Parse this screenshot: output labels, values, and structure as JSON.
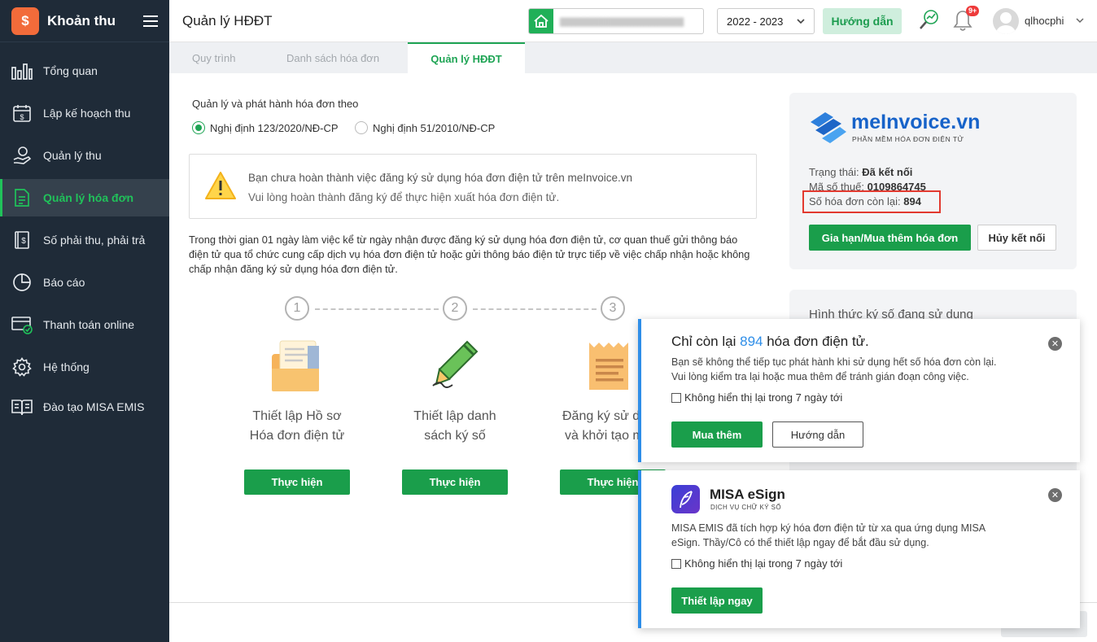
{
  "app": {
    "name": "Khoản thu"
  },
  "sidebar": {
    "items": [
      {
        "label": "Tổng quan",
        "icon": "bar-chart-icon"
      },
      {
        "label": "Lập kế hoạch thu",
        "icon": "calendar-money-icon"
      },
      {
        "label": "Quản lý thu",
        "icon": "hand-coin-icon"
      },
      {
        "label": "Quản lý hóa đơn",
        "icon": "invoice-document-icon",
        "active": true
      },
      {
        "label": "Số phải thu, phải trả",
        "icon": "money-book-icon"
      },
      {
        "label": "Báo cáo",
        "icon": "pie-chart-icon"
      },
      {
        "label": "Thanh toán online",
        "icon": "online-payment-icon"
      },
      {
        "label": "Hệ thống",
        "icon": "gear-icon"
      },
      {
        "label": "Đào tạo MISA EMIS",
        "icon": "open-book-icon"
      }
    ]
  },
  "header": {
    "title": "Quản lý HĐĐT",
    "year": "2022 - 2023",
    "guide": "Hướng dẫn",
    "notif_badge": "9+",
    "user": "qlhocphi"
  },
  "tabs": [
    {
      "label": "Quy trình",
      "active": false
    },
    {
      "label": "Danh sách hóa đơn",
      "active": false
    },
    {
      "label": "Quản lý HĐĐT",
      "active": true
    }
  ],
  "main": {
    "intro": "Quản lý và phát hành hóa đơn theo",
    "radio1": "Nghị định 123/2020/NĐ-CP",
    "radio2": "Nghị định 51/2010/NĐ-CP",
    "warning_line1": "Bạn chưa hoàn thành việc đăng ký sử dụng hóa đơn điện tử trên meInvoice.vn",
    "warning_line2": "Vui lòng hoàn thành đăng ký để thực hiện xuất hóa đơn điện tử.",
    "paragraph": "Trong thời gian 01 ngày làm việc kể từ ngày nhận được đăng ký sử dụng hóa đơn điện tử, cơ quan thuế gửi thông báo điện tử qua tổ chức cung cấp dịch vụ hóa đơn điện tử hoặc gửi thông báo điện tử trực tiếp về việc chấp nhận hoặc không chấp nhận đăng ký sử dụng hóa đơn điện tử.",
    "steps": [
      {
        "num": "1",
        "line1": "Thiết lập Hồ sơ",
        "line2": "Hóa đơn điện tử",
        "button": "Thực hiện"
      },
      {
        "num": "2",
        "line1": "Thiết lập danh",
        "line2": "sách ký số",
        "button": "Thực hiện"
      },
      {
        "num": "3",
        "line1": "Đăng ký sử d",
        "line2": "và khởi tạo m",
        "button": "Thực hiện"
      }
    ]
  },
  "meinvoice": {
    "brand": "meInvoice.vn",
    "tagline": "PHẦN MỀM HÓA ĐƠN ĐIỆN TỬ",
    "status_label": "Trạng thái:",
    "status_value": "Đã kết nối",
    "tax_label": "Mã số thuế:",
    "tax_value": "0109864745",
    "remaining_label": "Số hóa đơn còn lại:",
    "remaining_value": "894",
    "renew_button": "Gia hạn/Mua thêm hóa đơn",
    "disconnect_button": "Hủy kết nối",
    "sign_method_title": "Hình thức ký số đang sử dụng"
  },
  "popup1": {
    "title_prefix": "Chỉ còn lại",
    "title_count": "894",
    "title_suffix": "hóa đơn điện tử.",
    "line1": "Bạn sẽ không thể tiếp tục phát hành khi sử dụng hết số hóa đơn còn lại.",
    "line2": "Vui lòng kiểm tra lại hoặc mua thêm để tránh gián đoạn công việc.",
    "checkbox": "Không hiển thị lại trong 7 ngày tới",
    "buy_button": "Mua thêm",
    "guide_button": "Hướng dẫn"
  },
  "popup2": {
    "brand": "MISA eSign",
    "sub": "DỊCH VỤ CHỮ KÝ SỐ",
    "line1": "MISA EMIS đã tích hợp ký hóa đơn điện tử từ xa qua ứng dụng MISA",
    "line2": "eSign. Thầy/Cô có thể thiết lập ngay để bắt đầu sử dụng.",
    "checkbox": "Không hiển thị lại trong 7 ngày tới",
    "setup_button": "Thiết lập ngay"
  },
  "colors": {
    "sidebar": "#1f2b38",
    "accent": "#1a9e4b",
    "info": "#2e8ee8",
    "alert": "#e2392f",
    "brand_orange": "#f26b3a"
  }
}
